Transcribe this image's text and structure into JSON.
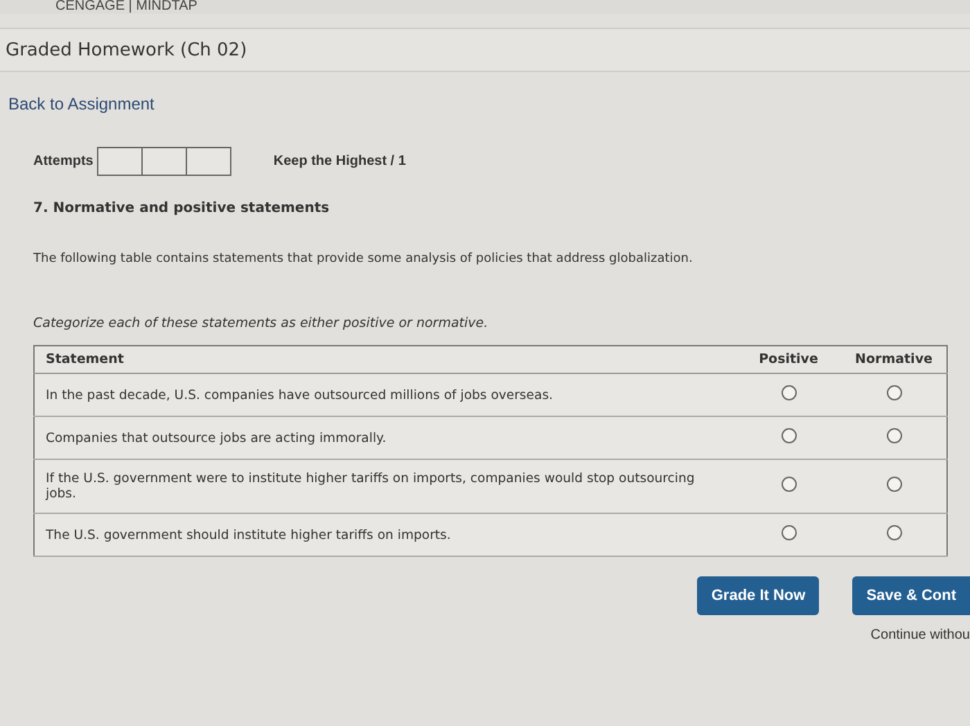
{
  "brand": "CENGAGE | MINDTAP",
  "title": "Graded Homework (Ch 02)",
  "back_link": "Back to Assignment",
  "attempts": {
    "label": "Attempts",
    "policy": "Keep the Highest / 1"
  },
  "question": {
    "title": "7. Normative and positive statements",
    "intro": "The following table contains statements that provide some analysis of policies that address globalization.",
    "instruction": "Categorize each of these statements as either positive or normative."
  },
  "table": {
    "columns": [
      "Statement",
      "Positive",
      "Normative"
    ],
    "rows": [
      {
        "statement": "In the past decade, U.S. companies have outsourced millions of jobs overseas.",
        "positive": {
          "selected": false
        },
        "normative": {
          "selected": false
        }
      },
      {
        "statement": "Companies that outsource jobs are acting immorally.",
        "positive": {
          "selected": false
        },
        "normative": {
          "selected": false
        }
      },
      {
        "statement": "If the U.S. government were to institute higher tariffs on imports, companies would stop outsourcing jobs.",
        "positive": {
          "selected": false
        },
        "normative": {
          "selected": false
        }
      },
      {
        "statement": "The U.S. government should institute higher tariffs on imports.",
        "positive": {
          "selected": false
        },
        "normative": {
          "selected": false
        }
      }
    ]
  },
  "buttons": [
    "Grade It Now",
    "Save & Cont"
  ],
  "continue_link": "Continue withou"
}
